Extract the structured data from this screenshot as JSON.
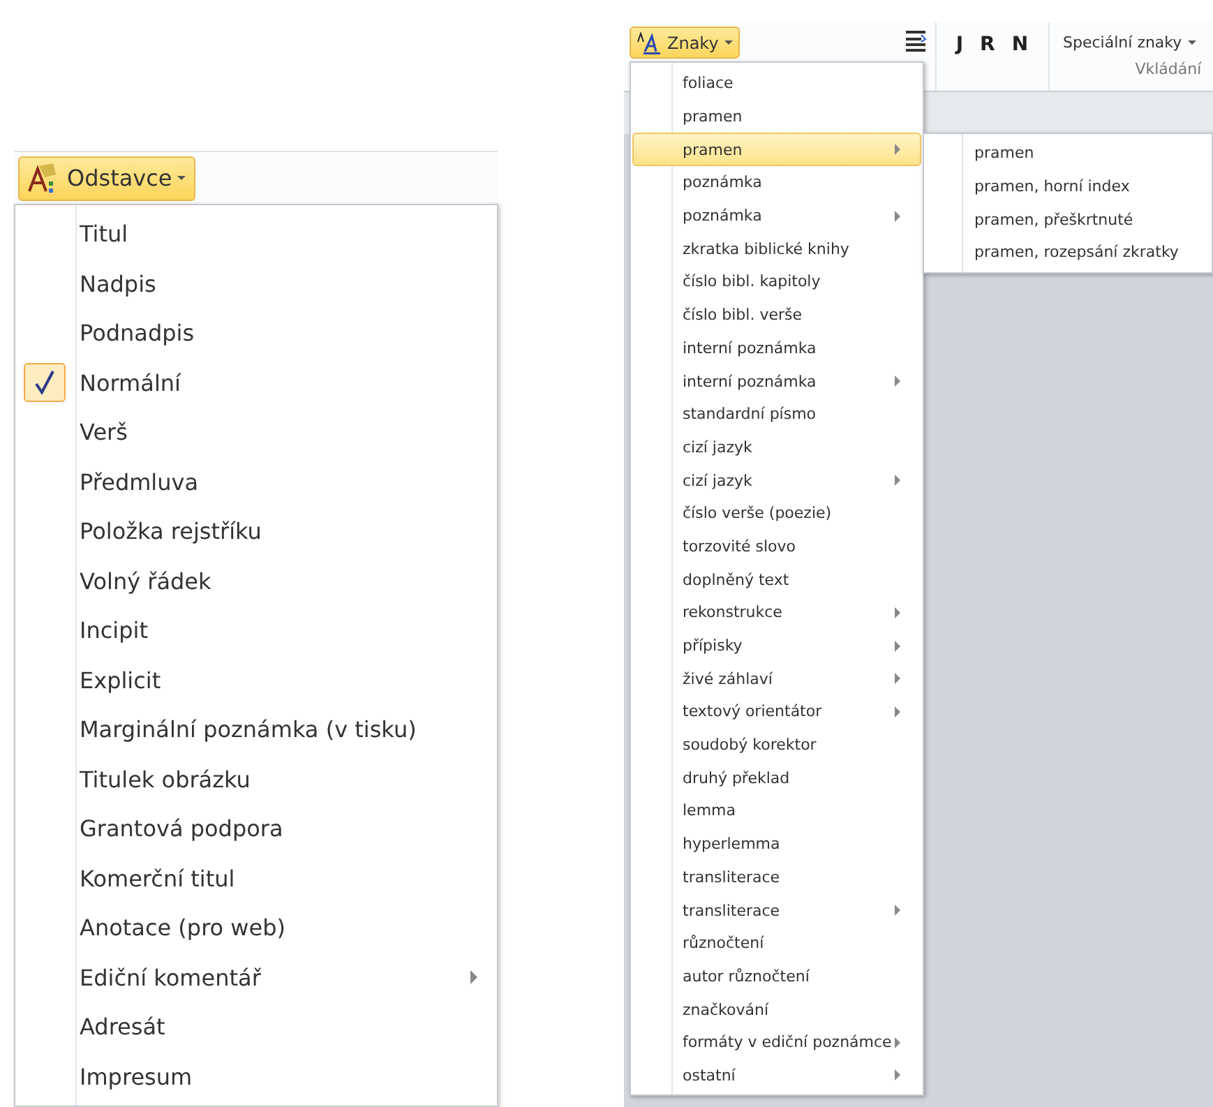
{
  "left": {
    "ribbon_button": {
      "label": "Odstavce",
      "active": true
    },
    "menu": [
      {
        "label": "Titul",
        "checked": false,
        "submenu": false
      },
      {
        "label": "Nadpis",
        "checked": false,
        "submenu": false
      },
      {
        "label": "Podnadpis",
        "checked": false,
        "submenu": false
      },
      {
        "label": "Normální",
        "checked": true,
        "submenu": false
      },
      {
        "label": "Verš",
        "checked": false,
        "submenu": false
      },
      {
        "label": "Předmluva",
        "checked": false,
        "submenu": false
      },
      {
        "label": "Položka rejstříku",
        "checked": false,
        "submenu": false
      },
      {
        "label": "Volný řádek",
        "checked": false,
        "submenu": false
      },
      {
        "label": "Incipit",
        "checked": false,
        "submenu": false
      },
      {
        "label": "Explicit",
        "checked": false,
        "submenu": false
      },
      {
        "label": "Marginální poznámka (v tisku)",
        "checked": false,
        "submenu": false
      },
      {
        "label": "Titulek obrázku",
        "checked": false,
        "submenu": false
      },
      {
        "label": "Grantová podpora",
        "checked": false,
        "submenu": false
      },
      {
        "label": "Komerční titul",
        "checked": false,
        "submenu": false
      },
      {
        "label": "Anotace (pro web)",
        "checked": false,
        "submenu": false
      },
      {
        "label": "Ediční komentář",
        "checked": false,
        "submenu": true
      },
      {
        "label": "Adresát",
        "checked": false,
        "submenu": false
      },
      {
        "label": "Impresum",
        "checked": false,
        "submenu": false
      }
    ]
  },
  "right": {
    "ribbon": {
      "znaky_button": {
        "label": "Znaky",
        "active": true
      },
      "format_buttons": [
        "J",
        "R",
        "N"
      ],
      "special_button": "Speciální znaky",
      "group_label": "Vkládání"
    },
    "menu": [
      {
        "label": "foliace",
        "selected": false,
        "submenu": false
      },
      {
        "label": "pramen",
        "selected": false,
        "submenu": false
      },
      {
        "label": "pramen",
        "selected": true,
        "submenu": true
      },
      {
        "label": "poznámka",
        "selected": false,
        "submenu": false
      },
      {
        "label": "poznámka",
        "selected": false,
        "submenu": true
      },
      {
        "label": "zkratka biblické knihy",
        "selected": false,
        "submenu": false
      },
      {
        "label": "číslo bibl. kapitoly",
        "selected": false,
        "submenu": false
      },
      {
        "label": "číslo bibl. verše",
        "selected": false,
        "submenu": false
      },
      {
        "label": "interní poznámka",
        "selected": false,
        "submenu": false
      },
      {
        "label": "interní poznámka",
        "selected": false,
        "submenu": true
      },
      {
        "label": "standardní písmo",
        "selected": false,
        "submenu": false
      },
      {
        "label": "cizí jazyk",
        "selected": false,
        "submenu": false
      },
      {
        "label": "cizí jazyk",
        "selected": false,
        "submenu": true
      },
      {
        "label": "číslo verše (poezie)",
        "selected": false,
        "submenu": false
      },
      {
        "label": "torzovité slovo",
        "selected": false,
        "submenu": false
      },
      {
        "label": "doplněný text",
        "selected": false,
        "submenu": false
      },
      {
        "label": "rekonstrukce",
        "selected": false,
        "submenu": true
      },
      {
        "label": "přípisky",
        "selected": false,
        "submenu": true
      },
      {
        "label": "živé záhlaví",
        "selected": false,
        "submenu": true
      },
      {
        "label": "textový orientátor",
        "selected": false,
        "submenu": true
      },
      {
        "label": "soudobý korektor",
        "selected": false,
        "submenu": false
      },
      {
        "label": "druhý překlad",
        "selected": false,
        "submenu": false
      },
      {
        "label": "lemma",
        "selected": false,
        "submenu": false
      },
      {
        "label": "hyperlemma",
        "selected": false,
        "submenu": false
      },
      {
        "label": "transliterace",
        "selected": false,
        "submenu": false
      },
      {
        "label": "transliterace",
        "selected": false,
        "submenu": true
      },
      {
        "label": "různočtení",
        "selected": false,
        "submenu": false
      },
      {
        "label": "autor různočtení",
        "selected": false,
        "submenu": false
      },
      {
        "label": "značkování",
        "selected": false,
        "submenu": false
      },
      {
        "label": "formáty v ediční poznámce",
        "selected": false,
        "submenu": true
      },
      {
        "label": "ostatní",
        "selected": false,
        "submenu": true
      }
    ],
    "submenu": [
      "pramen",
      "pramen, horní index",
      "pramen, přeškrtnuté",
      "pramen, rozepsání zkratky"
    ]
  }
}
